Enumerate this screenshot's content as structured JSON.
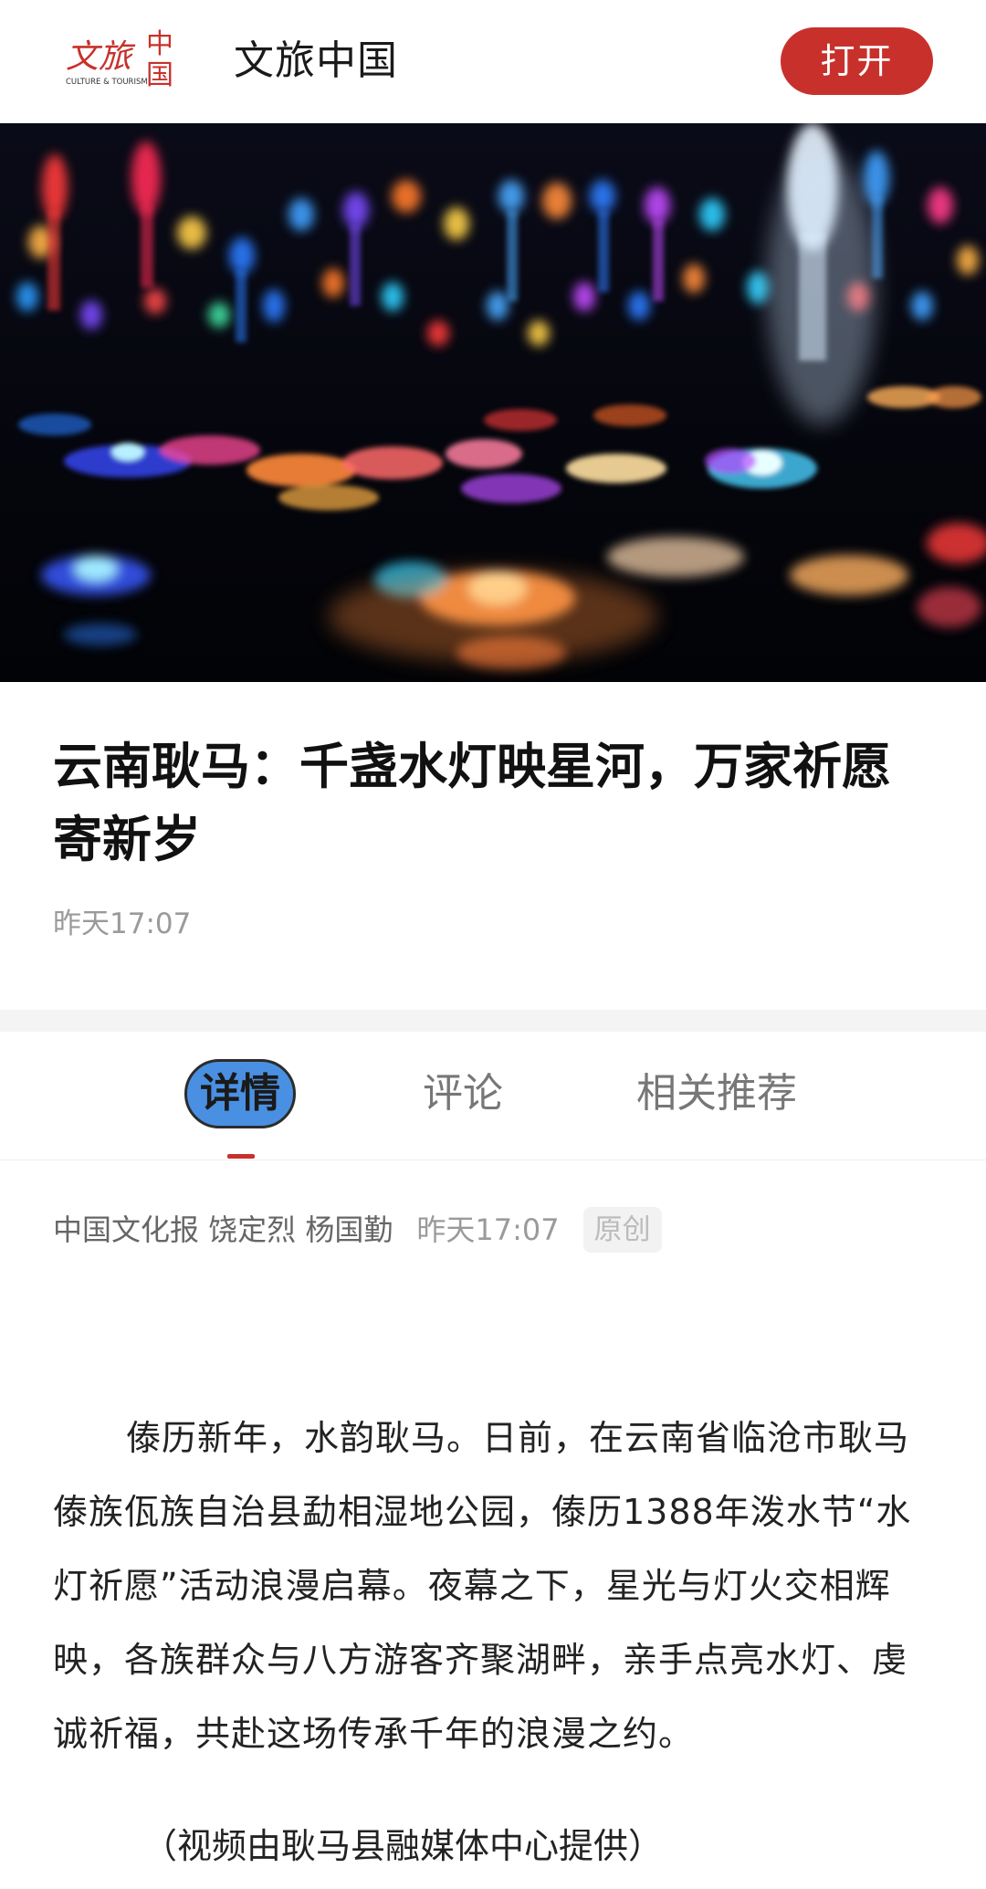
{
  "app": {
    "name": "文旅中国",
    "logo_text_cn": "文旅中国",
    "logo_text_en": "CULTURE & TOURISM",
    "open_button_label": "打开"
  },
  "article": {
    "title": "云南耿马：千盏水灯映星河，万家祈愿寄新岁",
    "published": "昨天17:07",
    "byline": {
      "source": "中国文化报 饶定烈 杨国勤",
      "date": "昨天17:07",
      "badge": "原创"
    },
    "paragraphs": [
      "傣历新年，水韵耿马。日前，在云南省临沧市耿马傣族佤族自治县勐相湿地公园，傣历1388年泼水节“水灯祈愿”活动浪漫启幕。夜幕之下，星光与灯火交相辉映，各族群众与八方游客齐聚湖畔，亲手点亮水灯、虔诚祈福，共赴这场传承千年的浪漫之约。"
    ],
    "caption": "（视频由耿马县融媒体中心提供）"
  },
  "tabs": [
    {
      "label": "详情",
      "active": true
    },
    {
      "label": "评论",
      "active": false
    },
    {
      "label": "相关推荐",
      "active": false
    }
  ],
  "colors": {
    "brand_red": "#c8312b",
    "active_tab_bg": "#4a90e2",
    "muted_text": "#9a9a9a"
  },
  "icons": {
    "logo": "culture-tourism-logo"
  }
}
